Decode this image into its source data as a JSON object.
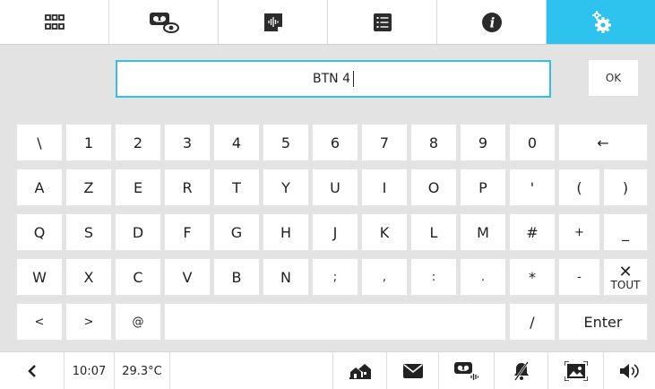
{
  "tabs": [
    {
      "name": "apps-grid-icon"
    },
    {
      "name": "answering-machine-icon"
    },
    {
      "name": "audio-message-icon"
    },
    {
      "name": "list-icon"
    },
    {
      "name": "info-icon"
    },
    {
      "name": "settings-gears-icon",
      "active": true
    }
  ],
  "input": {
    "value": "BTN 4"
  },
  "ok_label": "OK",
  "keyboard": {
    "row1": [
      "\\",
      "1",
      "2",
      "3",
      "4",
      "5",
      "6",
      "7",
      "8",
      "9",
      "0"
    ],
    "backspace": "←",
    "row2": [
      "A",
      "Z",
      "E",
      "R",
      "T",
      "Y",
      "U",
      "I",
      "O",
      "P",
      "'",
      "(",
      ")"
    ],
    "row3": [
      "Q",
      "S",
      "D",
      "F",
      "G",
      "H",
      "J",
      "K",
      "L",
      "M",
      "#",
      "+",
      "_"
    ],
    "row4": [
      "W",
      "X",
      "C",
      "V",
      "B",
      "N",
      ";",
      ",",
      ":",
      ".",
      "*",
      "-"
    ],
    "clear_symbol": "✕",
    "clear_label": "TOUT",
    "row5": [
      "<",
      ">",
      "@"
    ],
    "slash": "/",
    "enter": "Enter"
  },
  "statusbar": {
    "time": "10:07",
    "temperature": "29.3°C"
  },
  "colors": {
    "accent": "#2ec2ee"
  }
}
